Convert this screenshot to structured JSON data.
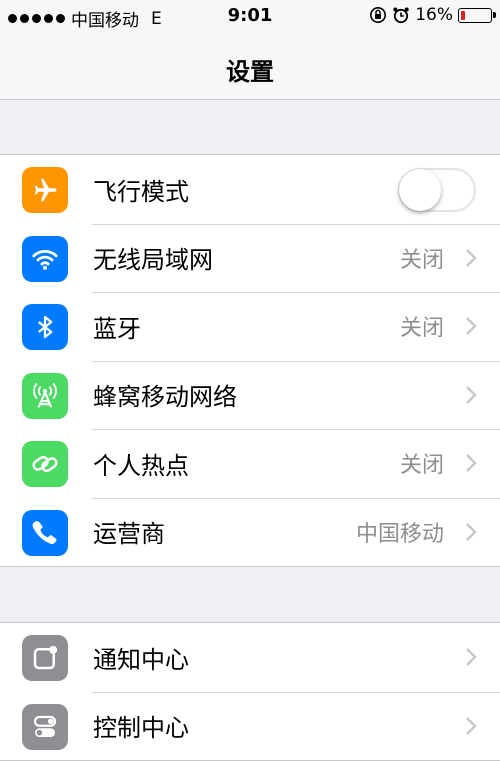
{
  "status_bar": {
    "carrier": "中国移动",
    "network": "E",
    "time": "9:01",
    "battery_percent": "16%",
    "battery_level": 0.16,
    "icons": [
      "signal-dots",
      "orientation-lock",
      "alarm-clock",
      "battery"
    ]
  },
  "nav": {
    "title": "设置"
  },
  "colors": {
    "airplane": "#ff9500",
    "wifi": "#007aff",
    "bluetooth": "#007aff",
    "cellular": "#4cd964",
    "hotspot": "#4cd964",
    "carrier": "#007aff",
    "notifications": "#8e8e93",
    "control_center": "#8e8e93",
    "battery_low": "#e02020"
  },
  "settings": {
    "group1": [
      {
        "label": "飞行模式",
        "icon": "airplane-icon",
        "toggle_on": false
      },
      {
        "label": "无线局域网",
        "icon": "wifi-icon",
        "value": "关闭"
      },
      {
        "label": "蓝牙",
        "icon": "bluetooth-icon",
        "value": "关闭"
      },
      {
        "label": "蜂窝移动网络",
        "icon": "cellular-icon"
      },
      {
        "label": "个人热点",
        "icon": "hotspot-icon",
        "value": "关闭"
      },
      {
        "label": "运营商",
        "icon": "phone-icon",
        "value": "中国移动"
      }
    ],
    "group2": [
      {
        "label": "通知中心",
        "icon": "notifications-icon"
      },
      {
        "label": "控制中心",
        "icon": "control-center-icon"
      }
    ]
  }
}
